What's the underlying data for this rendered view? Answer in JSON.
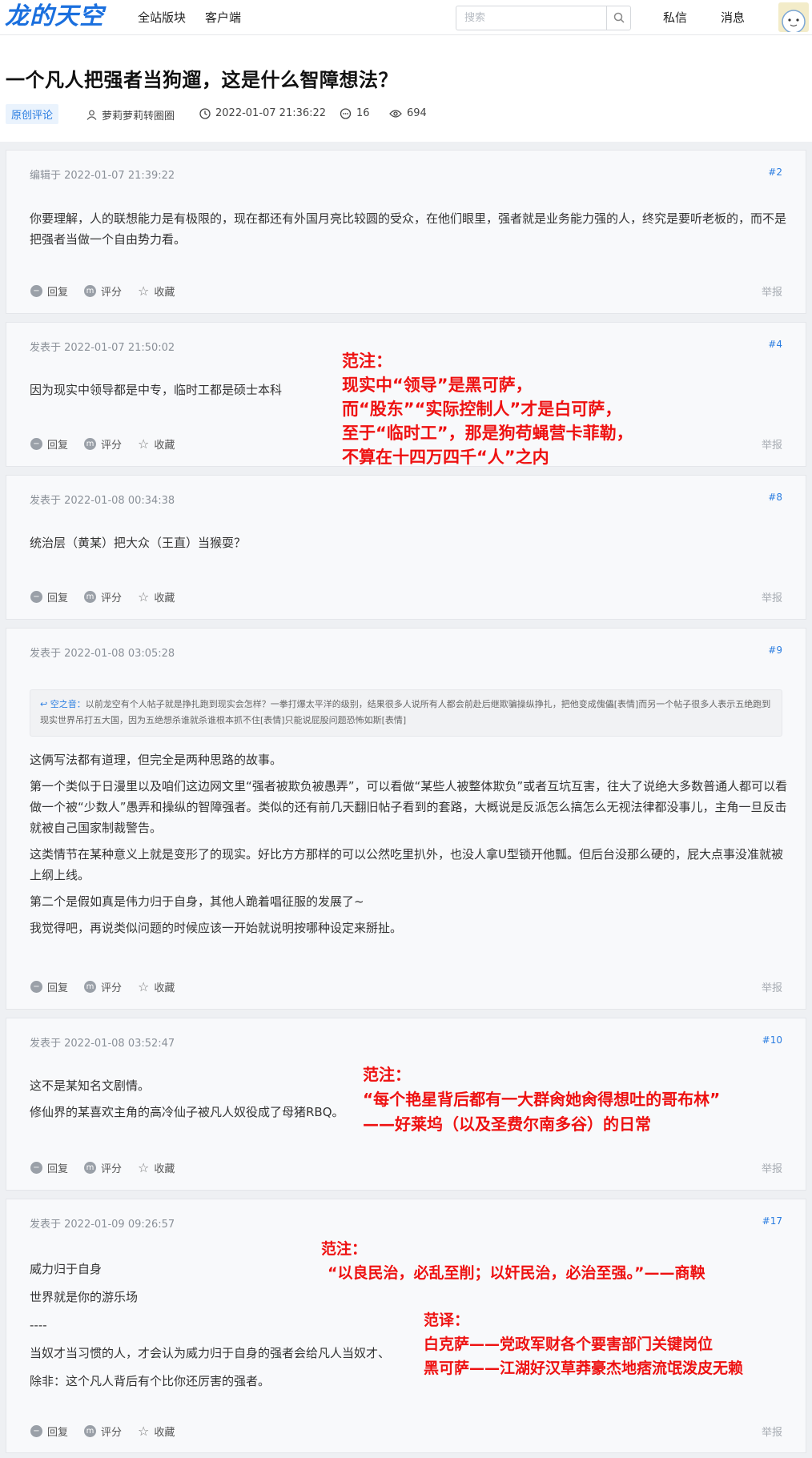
{
  "header": {
    "logo": "龙的天空",
    "nav": [
      "全站版块",
      "客户端"
    ],
    "search_placeholder": "搜索",
    "links": [
      "私信",
      "消息"
    ]
  },
  "thread": {
    "title": "一个凡人把强者当狗遛，这是什么智障想法？",
    "tag": "原创评论",
    "author": "萝莉萝莉转圈圈",
    "time": "2022-01-07 21:36:22",
    "replies": "16",
    "views": "694"
  },
  "labels": {
    "reply": "回复",
    "rate": "评分",
    "fav": "收藏",
    "report": "举报"
  },
  "posts": [
    {
      "time": "编辑于 2022-01-07 21:39:22",
      "floor": "#2",
      "paragraphs": [
        "你要理解，人的联想能力是有极限的，现在都还有外国月亮比较圆的受众，在他们眼里，强者就是业务能力强的人，终究是要听老板的，而不是把强者当做一个自由势力看。"
      ]
    },
    {
      "time": "发表于 2022-01-07 21:50:02",
      "floor": "#4",
      "paragraphs": [
        "因为现实中领导都是中专，临时工都是硕士本科"
      ]
    },
    {
      "time": "发表于 2022-01-08 00:34:38",
      "floor": "#8",
      "paragraphs": [
        "统治层（黄某）把大众（王直）当猴耍？"
      ]
    },
    {
      "time": "发表于 2022-01-08 03:05:28",
      "floor": "#9",
      "quote": {
        "name": "空之音：",
        "text": "以前龙空有个人帖子就是挣扎跑到现实会怎样？一拳打爆太平洋的级别，结果很多人说所有人都会前赴后继欺骗操纵挣扎，把他变成傀儡[表情]而另一个帖子很多人表示五绝跑到现实世界吊打五大国，因为五绝想杀谁就杀谁根本抓不住[表情]只能说屁股问题恐怖如斯[表情]"
      },
      "paragraphs": [
        "这俩写法都有道理，但完全是两种思路的故事。",
        "第一个类似于日漫里以及咱们这边网文里“强者被欺负被愚弄”，可以看做“某些人被整体欺负”或者互坑互害，往大了说绝大多数普通人都可以看做一个被“少数人”愚弄和操纵的智障强者。类似的还有前几天翻旧帖子看到的套路，大概说是反派怎么搞怎么无视法律都没事儿，主角一旦反击就被自己国家制裁警告。",
        "这类情节在某种意义上就是变形了的现实。好比方方那样的可以公然吃里扒外，也没人拿U型锁开他瓢。但后台没那么硬的，屁大点事没准就被上纲上线。",
        "第二个是假如真是伟力归于自身，其他人跪着唱征服的发展了~",
        "我觉得吧，再说类似问题的时候应该一开始就说明按哪种设定来掰扯。"
      ]
    },
    {
      "time": "发表于 2022-01-08 03:52:47",
      "floor": "#10",
      "paragraphs": [
        "这不是某知名文剧情。",
        "修仙界的某喜欢主角的高冷仙子被凡人奴役成了母猪RBQ。"
      ]
    },
    {
      "time": "发表于 2022-01-09 09:26:57",
      "floor": "#17",
      "paragraphs": [
        "威力归于自身",
        "世界就是你的游乐场",
        "----",
        "当奴才当习惯的人，才会认为威力归于自身的强者会给凡人当奴才、",
        "除非：这个凡人背后有个比你还厉害的强者。"
      ]
    }
  ],
  "annotations": [
    [
      "范注：",
      "现实中“领导”是黑可萨，",
      "而“股东”“实际控制人”才是白可萨，",
      "至于“临时工”，那是狗苟蝇营卡菲勒，",
      "不算在十四万四千“人”之内"
    ],
    [
      "范注：",
      "“每个艳星背后都有一大群肏她肏得想吐的哥布林”",
      "——好莱坞（以及圣费尔南多谷）的日常"
    ],
    [
      "范注：",
      "“以良民治，必乱至削；以奸民治，必治至强。”——商鞅"
    ],
    [
      "范译：",
      "白克萨——党政军财各个要害部门关键岗位",
      "黑可萨——江湖好汉草莽豪杰地痞流氓泼皮无赖"
    ]
  ]
}
